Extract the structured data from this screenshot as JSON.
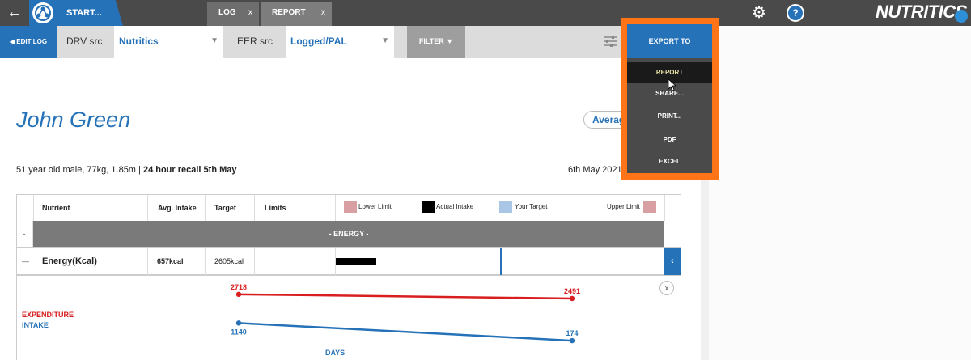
{
  "topbar": {
    "start_label": "START...",
    "tabs": [
      {
        "label": "LOG",
        "close": "x"
      },
      {
        "label": "REPORT",
        "close": "x"
      }
    ],
    "brand": "NUTRITICS",
    "help": "?"
  },
  "toolbar": {
    "edit_log": "◀ EDIT LOG",
    "drv_label": "DRV src",
    "drv_value": "Nutritics",
    "eer_label": "EER src",
    "eer_value": "Logged/PAL",
    "filter": "FILTER ▼"
  },
  "export_menu": {
    "button": "EXPORT TO",
    "items": [
      "REPORT",
      "SHARE...",
      "PRINT...",
      "PDF",
      "EXCEL"
    ]
  },
  "report": {
    "name": "John Green",
    "average_pill": "Average",
    "description_plain": "51 year old male, 77kg, 1.85m | ",
    "description_bold": "24 hour recall 5th May",
    "date": "6th May 2021"
  },
  "table": {
    "headers": {
      "nutrient": "Nutrient",
      "avg_intake": "Avg. Intake",
      "target": "Target",
      "limits": "Limits"
    },
    "legend": {
      "lower_limit": "Lower Limit",
      "actual_intake": "Actual Intake",
      "your_target": "Your Target",
      "upper_limit": "Upper Limit"
    },
    "section": "- ENERGY -",
    "section_toggle": "-",
    "row": {
      "toggle": "—",
      "nutrient": "Energy(Kcal)",
      "avg_intake": "657kcal",
      "target": "2605kcal",
      "collapse": "‹",
      "intake_fraction": 0.2,
      "target_fraction": 0.5
    },
    "colors": {
      "lower_limit": "#d9a0a4",
      "actual_intake": "#000000",
      "your_target": "#a9c6e6",
      "upper_limit": "#d9a0a4"
    }
  },
  "trend_chart": {
    "close": "x",
    "expenditure_label": "EXPENDITURE",
    "intake_label": "INTAKE",
    "x_label": "DAYS"
  },
  "chart_data": {
    "type": "line",
    "xlabel": "DAYS",
    "ylabel": "",
    "series": [
      {
        "name": "EXPENDITURE",
        "color": "#d81e1e",
        "values": [
          2718,
          2491
        ]
      },
      {
        "name": "INTAKE",
        "color": "#2672b8",
        "values": [
          1140,
          174
        ]
      }
    ],
    "point_labels": [
      [
        "2718",
        "2491"
      ],
      [
        "1140",
        "174"
      ]
    ]
  }
}
